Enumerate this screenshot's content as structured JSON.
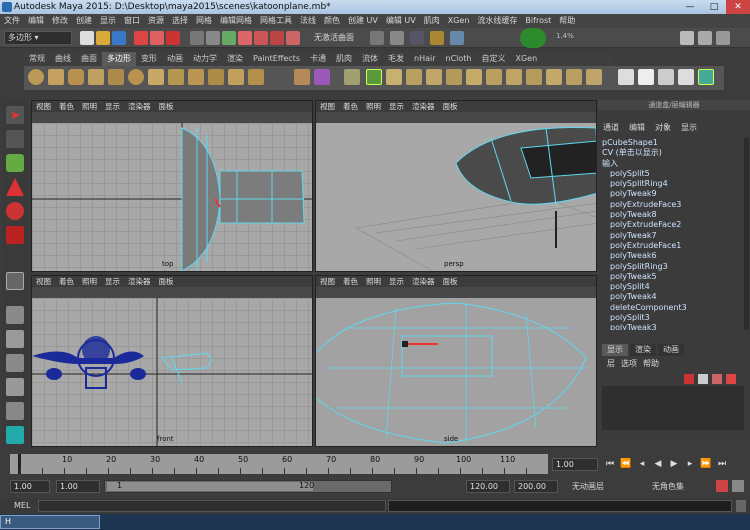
{
  "window": {
    "title": "Autodesk Maya 2015: D:\\Desktop\\maya2015\\scenes\\katoonplane.mb*",
    "minimize": "—",
    "maximize": "□",
    "close": "✕"
  },
  "menubar": [
    "文件",
    "编辑",
    "修改",
    "创建",
    "显示",
    "窗口",
    "资源",
    "选择",
    "网格",
    "编辑网格",
    "网格工具",
    "法线",
    "颜色",
    "创建 UV",
    "编辑 UV",
    "肌肉",
    "XGen",
    "流水线缓存",
    "Bifrost",
    "帮助"
  ],
  "statusline": {
    "mode": "多边形",
    "live_surface": "无激活曲面",
    "indicator": "1.4%"
  },
  "shelf_tabs": [
    "常规",
    "曲线",
    "曲面",
    "多边形",
    "变形",
    "动画",
    "动力学",
    "渲染",
    "PaintEffects",
    "卡通",
    "肌肉",
    "流体",
    "毛发",
    "nHair",
    "nCloth",
    "自定义",
    "XGen"
  ],
  "shelf_active": "多边形",
  "viewport_menu": [
    "视图",
    "着色",
    "照明",
    "显示",
    "渲染器",
    "面板"
  ],
  "viewports": {
    "top": {
      "label": "top"
    },
    "persp": {
      "label": "persp"
    },
    "front": {
      "label": "front"
    },
    "side": {
      "label": "side"
    }
  },
  "channel_box": {
    "title": "通道盒/层编辑器",
    "menu": [
      "通道",
      "编辑",
      "对象",
      "显示"
    ],
    "object": "pCubeShape1",
    "cv_note": "CV (单击以显示)",
    "inputs_label": "输入",
    "inputs": [
      "polySplit5",
      "polySplitRing4",
      "polyTweak9",
      "polyExtrudeFace3",
      "polyTweak8",
      "polyExtrudeFace2",
      "polyTweak7",
      "polyExtrudeFace1",
      "polyTweak6",
      "polySplitRing3",
      "polyTweak5",
      "polySplit4",
      "polyTweak4",
      "deleteComponent3",
      "polySplit3",
      "polyTweak3"
    ]
  },
  "layer_editor": {
    "tabs": [
      "显示",
      "渲染",
      "动画"
    ],
    "menu": [
      "层",
      "选项",
      "帮助"
    ]
  },
  "timeline": {
    "ticks": [
      "1",
      "5",
      "10",
      "15",
      "20",
      "25",
      "30",
      "35",
      "40",
      "45",
      "50",
      "55",
      "60",
      "65",
      "70",
      "75",
      "80",
      "85",
      "90",
      "95",
      "100",
      "105",
      "110",
      "115"
    ],
    "labeled": [
      "10",
      "20",
      "30",
      "40",
      "50",
      "60",
      "70",
      "80",
      "90",
      "100",
      "110"
    ],
    "current_frame": "1.00"
  },
  "range": {
    "start": "1.00",
    "playback_start": "1.00",
    "slider_start": "1",
    "slider_end": "120",
    "playback_end": "120.00",
    "end": "200.00",
    "anim_layer": "无动画层",
    "char_set": "无角色集"
  },
  "command_line": {
    "label": "MEL"
  },
  "taskbar": {
    "item": "H"
  },
  "colors": {
    "accent_blue": "#1a2a9a",
    "wire_cyan": "#5fd8f0",
    "viewport_bg": "#a8a8a8"
  }
}
